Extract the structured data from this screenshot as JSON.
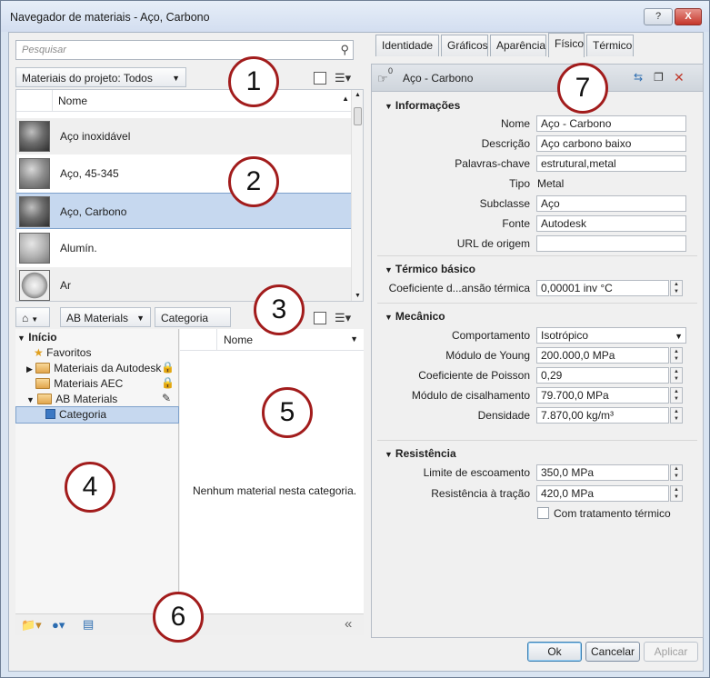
{
  "window": {
    "title": "Navegador de materiais - Aço, Carbono",
    "help_label": "?",
    "close_label": "X"
  },
  "search": {
    "placeholder": "Pesquisar"
  },
  "project_filter": {
    "label": "Materiais do projeto: Todos"
  },
  "material_list": {
    "header": "Nome",
    "items": [
      {
        "name": "Aço inoxidável",
        "thumb": "metal"
      },
      {
        "name": "Aço, 45-345",
        "thumb": "dull"
      },
      {
        "name": "Aço, Carbono",
        "thumb": "metal",
        "selected": true
      },
      {
        "name": "Alumín.",
        "thumb": "light"
      },
      {
        "name": "Ar",
        "thumb": "ball"
      }
    ]
  },
  "library_nav": {
    "home_icon": "home-icon",
    "library": "AB Materials",
    "category": "Categoria"
  },
  "tree": {
    "root": "Início",
    "items": [
      {
        "label": "Favoritos",
        "icon": "star-icon"
      },
      {
        "label": "Materiais da Autodesk",
        "icon": "folder-icon",
        "locked": true
      },
      {
        "label": "Materiais AEC",
        "icon": "folder-icon",
        "locked": true
      },
      {
        "label": "AB Materials",
        "icon": "folder-icon",
        "editable": true
      },
      {
        "label": "Categoria",
        "icon": "category-icon",
        "selected": true
      }
    ]
  },
  "category_list": {
    "header": "Nome",
    "empty_message": "Nenhum material nesta categoria."
  },
  "tabs": [
    "Identidade",
    "Gráficos",
    "Aparência",
    "Físico",
    "Térmico"
  ],
  "active_tab": "Físico",
  "asset": {
    "name": "Aço - Carbono",
    "count": "0"
  },
  "sections": {
    "info": "Informações",
    "thermal": "Térmico básico",
    "mechanical": "Mecânico",
    "strength": "Resistência"
  },
  "info": {
    "name_label": "Nome",
    "name_value": "Aço - Carbono",
    "desc_label": "Descrição",
    "desc_value": "Aço carbono baixo",
    "keywords_label": "Palavras-chave",
    "keywords_value": "estrutural,metal",
    "type_label": "Tipo",
    "type_value": "Metal",
    "subclass_label": "Subclasse",
    "subclass_value": "Aço",
    "source_label": "Fonte",
    "source_value": "Autodesk",
    "url_label": "URL de origem",
    "url_value": ""
  },
  "thermal": {
    "coef_label": "Coeficiente d...ansão térmica",
    "coef_value": "0,00001 inv °C"
  },
  "mechanical": {
    "behavior_label": "Comportamento",
    "behavior_value": "Isotrópico",
    "young_label": "Módulo de Young",
    "young_value": "200.000,0 MPa",
    "poisson_label": "Coeficiente de Poisson",
    "poisson_value": "0,29",
    "shear_label": "Módulo de cisalhamento",
    "shear_value": "79.700,0 MPa",
    "density_label": "Densidade",
    "density_value": "7.870,00 kg/m³"
  },
  "strength": {
    "yield_label": "Limite de escoamento",
    "yield_value": "350,0 MPa",
    "tensile_label": "Resistência à tração",
    "tensile_value": "420,0 MPa",
    "heat_label": "Com tratamento térmico",
    "heat_checked": false
  },
  "buttons": {
    "ok": "Ok",
    "cancel": "Cancelar",
    "apply": "Aplicar"
  },
  "callouts": [
    "1",
    "2",
    "3",
    "4",
    "5",
    "6",
    "7"
  ],
  "colors": {
    "accent": "#a21c1c",
    "selection": "#c6d8ef"
  }
}
